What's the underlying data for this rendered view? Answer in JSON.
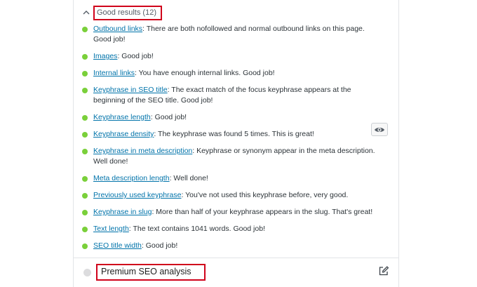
{
  "good_results": {
    "title": "Good results (12)",
    "items": [
      {
        "link": "Outbound links",
        "text": ": There are both nofollowed and normal outbound links on this page. Good job!"
      },
      {
        "link": "Images",
        "text": ": Good job!"
      },
      {
        "link": "Internal links",
        "text": ": You have enough internal links. Good job!"
      },
      {
        "link": "Keyphrase in SEO title",
        "text": ": The exact match of the focus keyphrase appears at the beginning of the SEO title. Good job!"
      },
      {
        "link": "Keyphrase length",
        "text": ": Good job!"
      },
      {
        "link": "Keyphrase density",
        "text": ": The keyphrase was found 5 times. This is great!"
      },
      {
        "link": "Keyphrase in meta description",
        "text": ": Keyphrase or synonym appear in the meta description. Well done!"
      },
      {
        "link": "Meta description length",
        "text": ": Well done!"
      },
      {
        "link": "Previously used keyphrase",
        "text": ": You've not used this keyphrase before, very good."
      },
      {
        "link": "Keyphrase in slug",
        "text": ": More than half of your keyphrase appears in the slug. That's great!"
      },
      {
        "link": "Text length",
        "text": ": The text contains 1041 words. Good job!"
      },
      {
        "link": "SEO title width",
        "text": ": Good job!"
      }
    ]
  },
  "premium": {
    "title": "Premium SEO analysis"
  },
  "icons": {
    "toggle": "chevron-up-icon",
    "highlight": "eye-icon",
    "edit": "edit-icon"
  },
  "colors": {
    "good_bullet": "#7ad03a",
    "link": "#0073aa",
    "highlight_box": "#d0021b",
    "premium_bullet": "#dcdcde"
  }
}
